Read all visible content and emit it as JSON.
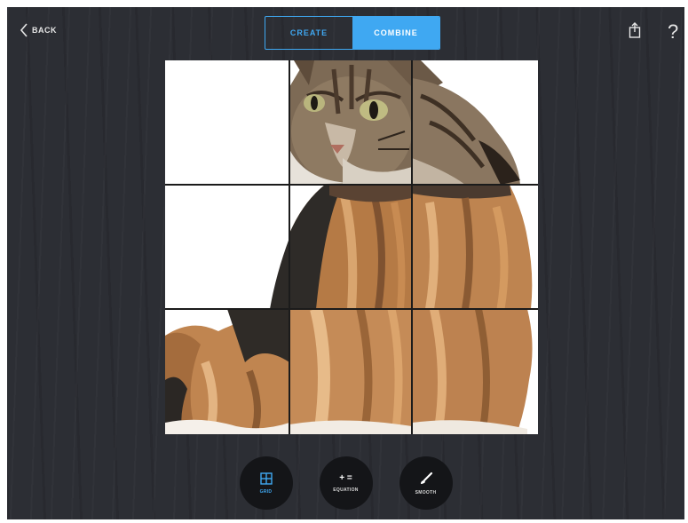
{
  "header": {
    "back_label": "BACK",
    "segments": {
      "create": "CREATE",
      "combine": "COMBINE",
      "selected": "combine"
    },
    "share_icon": "share-icon",
    "help_label": "?"
  },
  "canvas": {
    "grid": {
      "rows": 3,
      "cols": 3
    },
    "tiles": [
      {
        "content": "blank"
      },
      {
        "content": "cat-face"
      },
      {
        "content": "cat-ear-cheek"
      },
      {
        "content": "blank"
      },
      {
        "content": "dog-body"
      },
      {
        "content": "dog-body"
      },
      {
        "content": "dog-legs"
      },
      {
        "content": "dog-chest"
      },
      {
        "content": "dog-body"
      }
    ]
  },
  "toolbar": {
    "items": [
      {
        "id": "grid",
        "label": "GRID",
        "icon": "grid-icon",
        "active": true
      },
      {
        "id": "equation",
        "label": "EQUATION",
        "icon": "equation-icon",
        "glyph": "+ =",
        "active": false
      },
      {
        "id": "smooth",
        "label": "SMOOTH",
        "icon": "brush-icon",
        "active": false
      }
    ]
  },
  "colors": {
    "accent": "#3fa8f2",
    "background": "#2c2e34",
    "tool_bg": "#141518",
    "gridline": "#1b1b1b"
  }
}
